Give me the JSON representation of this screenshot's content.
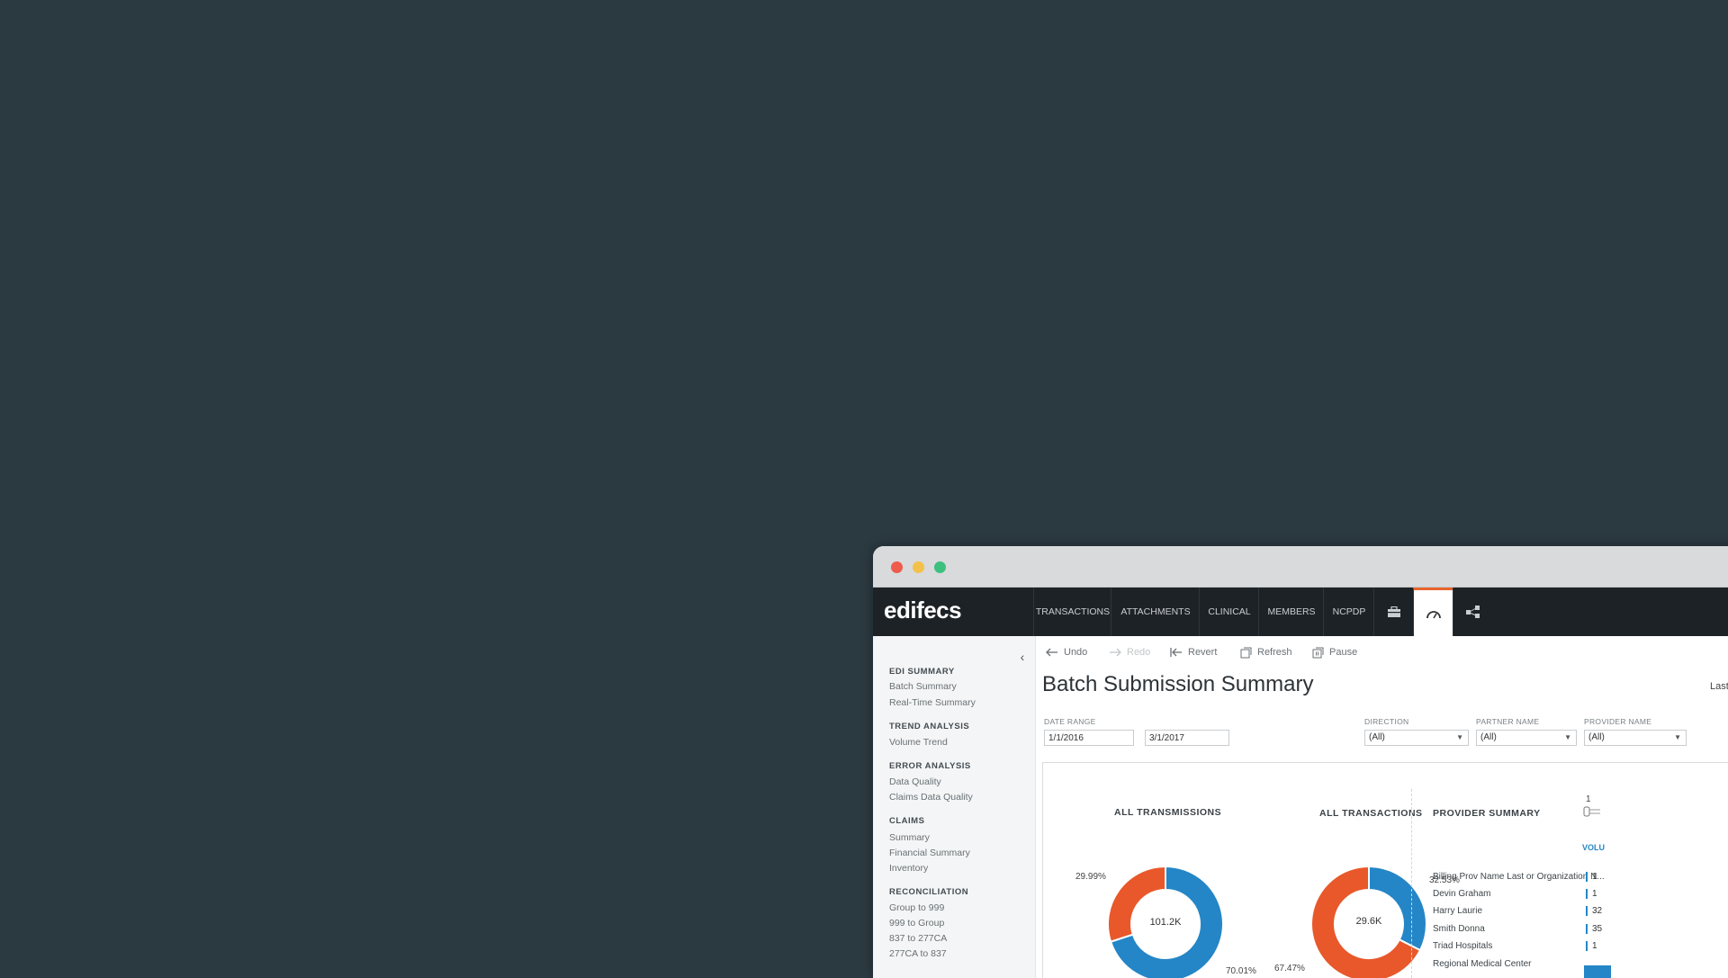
{
  "window": {
    "logo": "edifecs",
    "nav_tabs": [
      "TRANSACTIONS",
      "ATTACHMENTS",
      "CLINICAL",
      "MEMBERS",
      "NCPDP"
    ],
    "nav_icons": [
      "briefcase-icon",
      "gauge-icon",
      "share-icon"
    ],
    "active_icon": "gauge-icon",
    "accent_color": "#e8642c"
  },
  "toolbar": {
    "undo": "Undo",
    "redo": "Redo",
    "revert": "Revert",
    "refresh": "Refresh",
    "pause": "Pause"
  },
  "sidebar": {
    "sections": [
      {
        "heading": "EDI SUMMARY",
        "items": [
          "Batch Summary",
          "Real-Time Summary"
        ]
      },
      {
        "heading": "TREND ANALYSIS",
        "items": [
          "Volume Trend"
        ]
      },
      {
        "heading": "ERROR ANALYSIS",
        "items": [
          "Data Quality",
          "Claims Data Quality"
        ]
      },
      {
        "heading": "CLAIMS",
        "items": [
          "Summary",
          "Financial Summary",
          "Inventory"
        ]
      },
      {
        "heading": "RECONCILIATION",
        "items": [
          "Group to 999",
          "999 to Group",
          "837 to 277CA",
          "277CA to 837"
        ]
      }
    ]
  },
  "main": {
    "title": "Batch Submission Summary",
    "last_label": "Last",
    "filters": {
      "date_range_label": "DATE RANGE",
      "date_from": "1/1/2016",
      "date_to": "3/1/2017",
      "direction_label": "DIRECTION",
      "direction_value": "(All)",
      "partner_label": "PARTNER NAME",
      "partner_value": "(All)",
      "provider_label": "PROVIDER NAME",
      "provider_value": "(All)"
    },
    "provider_summary": {
      "title": "PROVIDER SUMMARY",
      "top_value": "1",
      "vol_label": "VOLU",
      "rows": [
        {
          "name": "Billing Prov Name Last or Organization N...",
          "value": "1"
        },
        {
          "name": "Devin Graham",
          "value": "1"
        },
        {
          "name": "Harry Laurie",
          "value": "32"
        },
        {
          "name": "Smith Donna",
          "value": "35"
        },
        {
          "name": "Triad Hospitals",
          "value": "1"
        },
        {
          "name": "Regional Medical Center",
          "value": ""
        }
      ]
    }
  },
  "chart_data": [
    {
      "type": "pie",
      "title": "ALL TRANSMISSIONS",
      "center_label": "101.2K",
      "slices": [
        {
          "label": "29.99%",
          "value": 29.99,
          "color": "#e8582a"
        },
        {
          "label": "70.01%",
          "value": 70.01,
          "color": "#2486c6"
        }
      ]
    },
    {
      "type": "pie",
      "title": "ALL TRANSACTIONS",
      "center_label": "29.6K",
      "slices": [
        {
          "label": "32.53%",
          "value": 32.53,
          "color": "#2486c6"
        },
        {
          "label": "67.47%",
          "value": 67.47,
          "color": "#e8582a"
        }
      ]
    }
  ]
}
